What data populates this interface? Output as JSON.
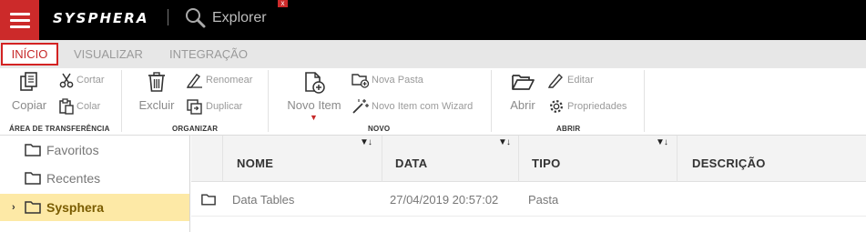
{
  "topbar": {
    "brand": "SYSPHERA",
    "app_title": "Explorer",
    "close_label": "x",
    "menu_icon": "hamburger-menu-icon",
    "search_icon": "search-icon",
    "accent": "#cc2a2a"
  },
  "tabs": [
    {
      "label": "INÍCIO",
      "active": true
    },
    {
      "label": "VISUALIZAR",
      "active": false
    },
    {
      "label": "INTEGRAÇÃO",
      "active": false
    }
  ],
  "ribbon": {
    "groups": [
      {
        "label": "ÁREA DE TRANSFERÊNCIA"
      },
      {
        "label": "ORGANIZAR"
      },
      {
        "label": "NOVO"
      },
      {
        "label": "ABRIR"
      }
    ],
    "buttons": {
      "copiar": "Copiar",
      "cortar": "Cortar",
      "colar": "Colar",
      "excluir": "Excluir",
      "renomear": "Renomear",
      "duplicar": "Duplicar",
      "novo_item": "Novo Item",
      "nova_pasta": "Nova Pasta",
      "novo_item_wizard": "Novo Item com Wizard",
      "abrir": "Abrir",
      "editar": "Editar",
      "propriedades": "Propriedades"
    }
  },
  "tree": {
    "items": [
      {
        "label": "Favoritos",
        "selected": false
      },
      {
        "label": "Recentes",
        "selected": false
      },
      {
        "label": "Sysphera",
        "selected": true
      }
    ]
  },
  "table": {
    "columns": [
      "NOME",
      "DATA",
      "TIPO",
      "DESCRIÇÃO"
    ],
    "filter_glyph": "▼↓",
    "rows": [
      {
        "nome": "Data Tables",
        "data": "27/04/2019 20:57:02",
        "tipo": "Pasta",
        "descricao": ""
      }
    ]
  },
  "colors": {
    "selected_row": "#fde9a6",
    "active_tab_border": "#d32222",
    "topbar_bg": "#000000"
  }
}
